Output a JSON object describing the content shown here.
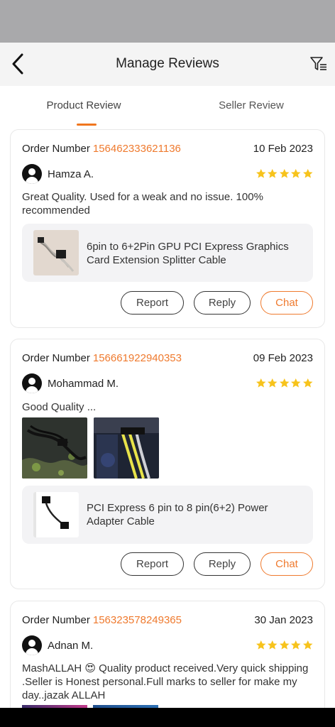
{
  "header": {
    "title": "Manage Reviews",
    "back_icon": "chevron-left-icon",
    "filter_icon": "filter-list-icon"
  },
  "tabs": [
    {
      "label": "Product Review",
      "active": true
    },
    {
      "label": "Seller Review",
      "active": false
    }
  ],
  "colors": {
    "accent": "#ef7a2e",
    "star": "#f7c31c"
  },
  "reviews": [
    {
      "order_label": "Order Number",
      "order_number": "156462333621136",
      "date": "10 Feb 2023",
      "user": "Hamza A.",
      "rating": 5,
      "comment": "Great Quality. Used for a weak and no issue. 100% recommended",
      "product": "6pin to 6+2Pin GPU PCI Express Graphics Card Extension Splitter Cable",
      "actions": {
        "report": "Report",
        "reply": "Reply",
        "chat": "Chat"
      }
    },
    {
      "order_label": "Order Number",
      "order_number": "156661922940353",
      "date": "09 Feb 2023",
      "user": "Mohammad M.",
      "rating": 5,
      "comment": "Good Quality ...",
      "product": "PCI Express 6 pin to 8 pin(6+2) Power Adapter Cable",
      "actions": {
        "report": "Report",
        "reply": "Reply",
        "chat": "Chat"
      }
    },
    {
      "order_label": "Order Number",
      "order_number": "156323578249365",
      "date": "30 Jan 2023",
      "user": "Adnan M.",
      "rating": 5,
      "comment": "MashALLAH 😍 Quality product received.Very quick shipping .Seller is Honest personal.Full marks to seller for make my day..jazak ALLAH"
    }
  ]
}
